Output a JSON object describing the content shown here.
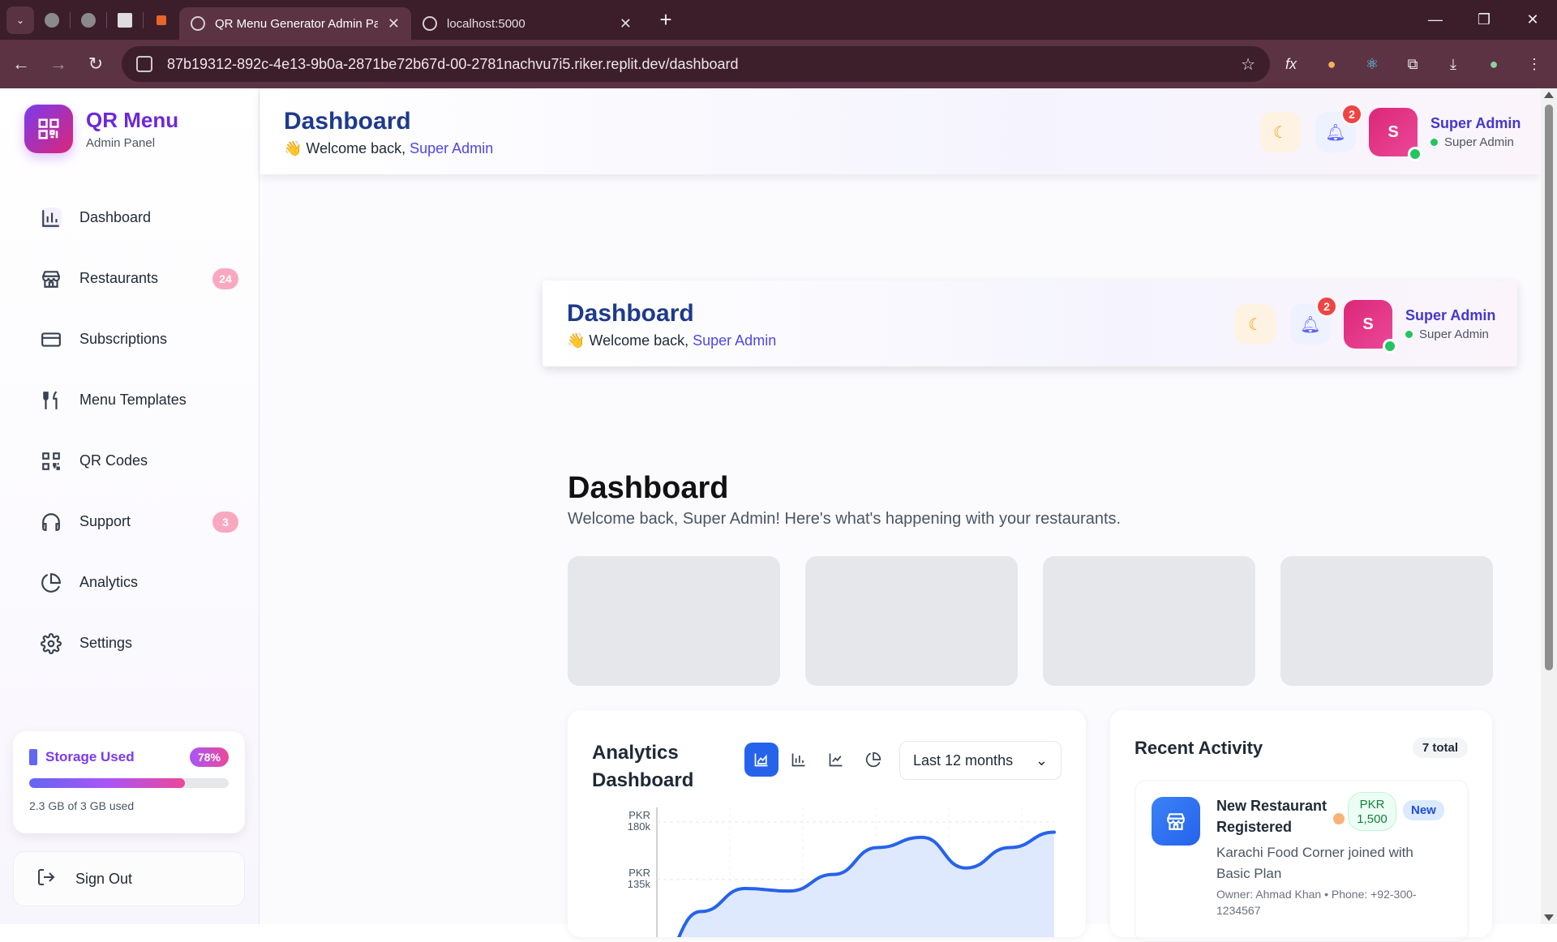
{
  "browser": {
    "tabs": [
      {
        "title": "QR Menu Generator Admin Panel",
        "active": true
      },
      {
        "title": "localhost:5000",
        "active": false
      }
    ],
    "url": "87b19312-892c-4e13-9b0a-2871be72b67d-00-2781nachvu7i5.riker.replit.dev/dashboard"
  },
  "sidebar": {
    "brand_title": "QR Menu",
    "brand_sub": "Admin Panel",
    "items": [
      {
        "label": "Dashboard",
        "icon": "bar-chart-icon"
      },
      {
        "label": "Restaurants",
        "icon": "store-icon",
        "badge": "24"
      },
      {
        "label": "Subscriptions",
        "icon": "credit-card-icon"
      },
      {
        "label": "Menu Templates",
        "icon": "utensils-icon"
      },
      {
        "label": "QR Codes",
        "icon": "qr-code-icon"
      },
      {
        "label": "Support",
        "icon": "headphones-icon",
        "badge": "3"
      },
      {
        "label": "Analytics",
        "icon": "pie-chart-icon"
      },
      {
        "label": "Settings",
        "icon": "gear-icon"
      }
    ],
    "storage": {
      "label": "Storage Used",
      "percent": "78%",
      "fill": 0.78,
      "used": "2.3 GB of 3 GB used"
    },
    "signout": "Sign Out"
  },
  "header": {
    "title": "Dashboard",
    "welcome_prefix": "👋 Welcome back, ",
    "welcome_name": "Super Admin",
    "notifications": "2",
    "avatar_letter": "S",
    "user_name": "Super Admin",
    "user_role": "Super Admin"
  },
  "main": {
    "title": "Dashboard",
    "subtitle": "Welcome back, Super Admin! Here's what's happening with your restaurants."
  },
  "analytics": {
    "title": "Analytics Dashboard",
    "range": "Last 12 months"
  },
  "chart_data": {
    "type": "area",
    "y_ticks": [
      "PKR 180k",
      "PKR 135k"
    ],
    "ylim": [
      90,
      185
    ],
    "values": [
      70,
      110,
      128,
      126,
      139,
      160,
      168,
      144,
      160,
      172
    ]
  },
  "activity": {
    "title": "Recent Activity",
    "count": "7 total",
    "item": {
      "title": "New Restaurant Registered",
      "amount": "PKR 1,500",
      "tag": "New",
      "desc": "Karachi Food Corner joined with Basic Plan",
      "owner": "Owner: Ahmad Khan • Phone: +92-300-1234567"
    }
  }
}
